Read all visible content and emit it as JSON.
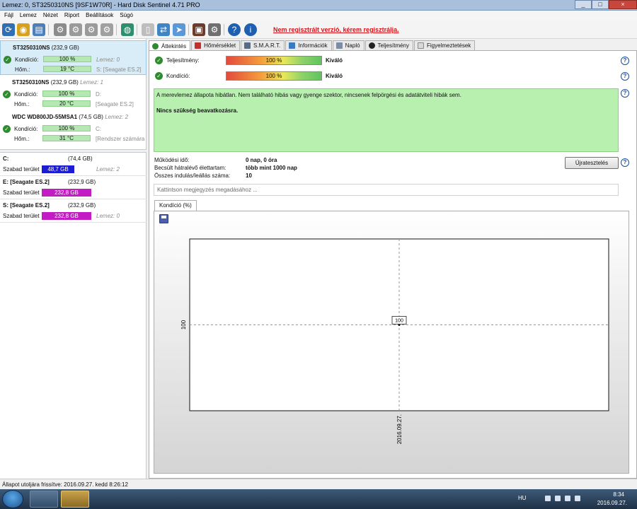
{
  "window": {
    "title": "Lemez: 0, ST3250310NS [9SF1W70R]  -  Hard Disk Sentinel 4.71 PRO",
    "min": "_",
    "max": "□",
    "close": "×"
  },
  "menu": [
    "Fájl",
    "Lemez",
    "Nézet",
    "Riport",
    "Beállítások",
    "Súgó"
  ],
  "toolbar": {
    "register_notice": "Nem regisztrált verzió, kérem regisztrálja."
  },
  "disks": [
    {
      "name": "ST3250310NS",
      "size": "(232,9 GB)",
      "index": "",
      "health_label": "Kondíció:",
      "health": "100 %",
      "temp_label": "Hőm.:",
      "temp": "19 °C",
      "extra1": "Lemez: 0",
      "extra2": "S: [Seagate ES.2]"
    },
    {
      "name": "ST3250310NS",
      "size": "(232,9 GB)",
      "index": "Lemez: 1",
      "health_label": "Kondíció:",
      "health": "100 %",
      "temp_label": "Hőm.:",
      "temp": "20 °C",
      "extra1": "D:",
      "extra2": "[Seagate ES.2]"
    },
    {
      "name": "WDC WD800JD-55MSA1",
      "size": "(74,5 GB)",
      "index": "Lemez: 2",
      "health_label": "Kondíció:",
      "health": "100 %",
      "temp_label": "Hőm.:",
      "temp": "31 °C",
      "extra1": "C:",
      "extra2": "[Rendszer számára"
    }
  ],
  "volumes": [
    {
      "name": "C:",
      "size": "(74,4 GB)",
      "label": "Szabad terület",
      "free": "48,7 GB",
      "note": "Lemez: 2",
      "color": "#1c1cd4",
      "fill": 0.654
    },
    {
      "name": "E: [Seagate ES.2]",
      "size": "(232,9 GB)",
      "label": "Szabad terület",
      "free": "232,8 GB",
      "note": "",
      "color": "#c41cc4",
      "fill": 1.0
    },
    {
      "name": "S: [Seagate ES.2]",
      "size": "(232,9 GB)",
      "label": "Szabad terület",
      "free": "232,8 GB",
      "note": "Lemez: 0",
      "color": "#c41cc4",
      "fill": 1.0
    }
  ],
  "tabs": [
    "Áttekintés",
    "Hőmérséklet",
    "S.M.A.R.T.",
    "Információk",
    "Napló",
    "Teljesítmény",
    "Figyelmeztetések"
  ],
  "metrics": {
    "performance": {
      "label": "Teljesítmény:",
      "value": "100 %",
      "rating": "Kiváló",
      "level": 100
    },
    "health": {
      "label": "Kondíció:",
      "value": "100 %",
      "rating": "Kiváló",
      "level": 100
    }
  },
  "status": {
    "message": "A merevlemez állapota hibátlan. Nem található hibás vagy gyenge szektor, nincsenek felpörgési és adatátviteli hibák sem.",
    "advice": "Nincs szükség beavatkozásra."
  },
  "info": {
    "uptime_label": "Működési idő:",
    "uptime": "0 nap, 0 óra",
    "lifetime_label": "Becsült hátralévő élettartam:",
    "lifetime": "több mint 1000 nap",
    "starts_label": "Összes indulás/leállás száma:",
    "starts": "10"
  },
  "retest_button": "Újratesztelés",
  "note_placeholder": "Kattintson megjegyzés megadásához ...",
  "chart_tab": "Kondíció  (%)",
  "statusbar": "Állapot utoljára frissítve: 2016.09.27. kedd 8:26:12",
  "taskbar": {
    "lang": "HU",
    "time": "8:34",
    "date": "2016.09.27."
  },
  "chart_data": {
    "type": "line",
    "x": [
      "2016.09.27."
    ],
    "series": [
      {
        "values": [
          100
        ]
      }
    ],
    "data_labels": [
      "100"
    ],
    "ytick_labels": [
      "100"
    ],
    "xtick_labels": [
      "2016.09.27."
    ],
    "grid": true
  }
}
